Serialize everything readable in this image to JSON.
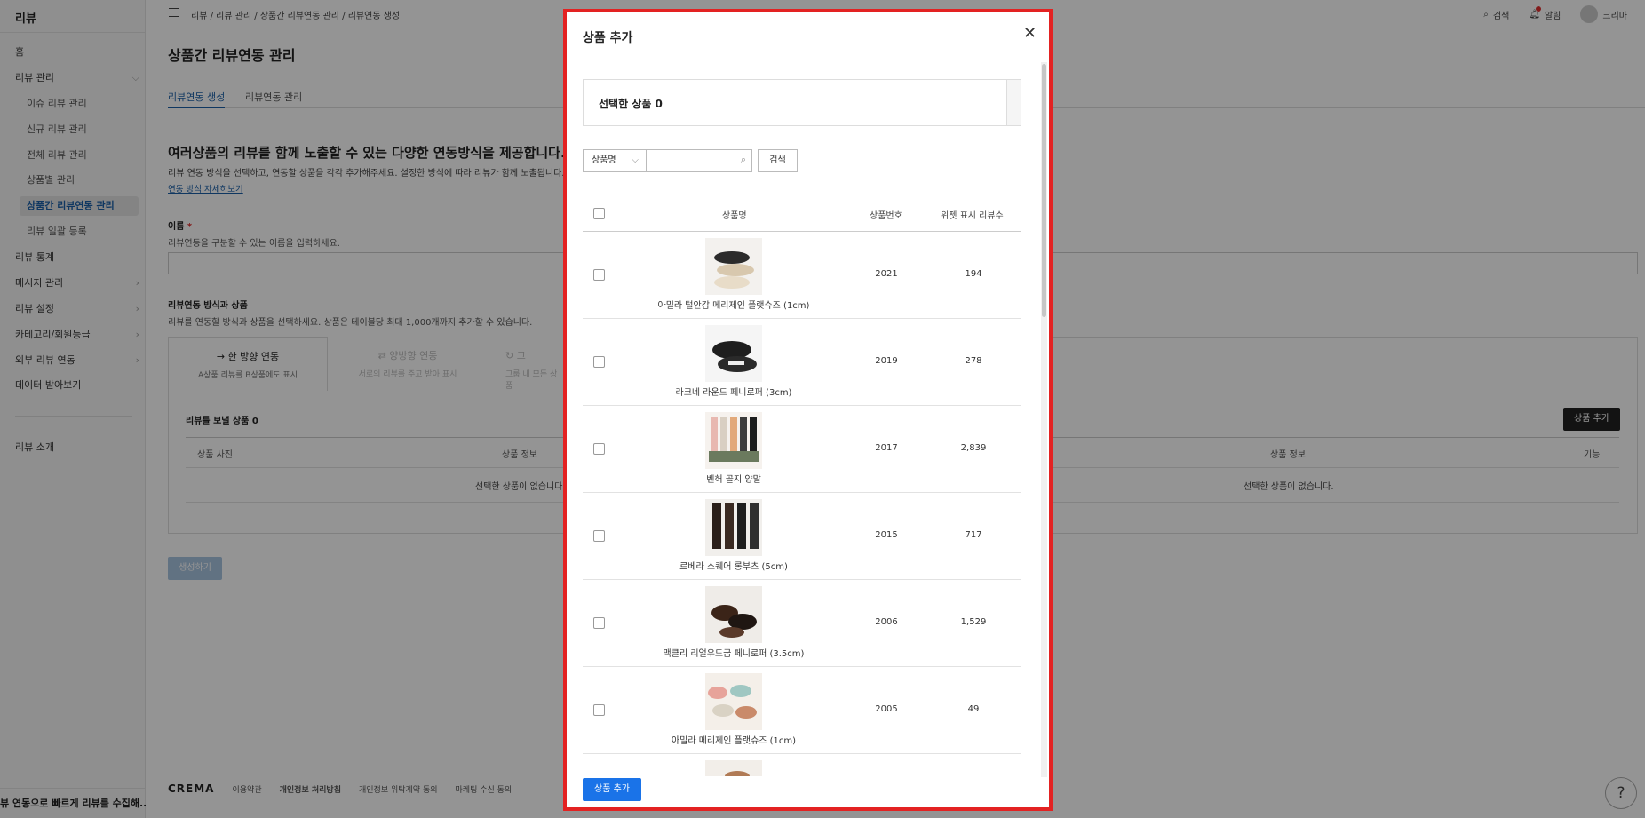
{
  "sidebar": {
    "title": "리뷰",
    "items": [
      {
        "label": "홈"
      },
      {
        "label": "리뷰 관리",
        "chevron": "⌵"
      },
      {
        "label": "이슈 리뷰 관리"
      },
      {
        "label": "신규 리뷰 관리"
      },
      {
        "label": "전체 리뷰 관리"
      },
      {
        "label": "상품별 관리"
      },
      {
        "label": "상품간 리뷰연동 관리"
      },
      {
        "label": "리뷰 일괄 등록"
      },
      {
        "label": "리뷰 통계"
      },
      {
        "label": "메시지 관리",
        "chevron": "›"
      },
      {
        "label": "리뷰 설정",
        "chevron": "›"
      },
      {
        "label": "카테고리/회원등급",
        "chevron": "›"
      },
      {
        "label": "외부 리뷰 연동",
        "chevron": "›"
      },
      {
        "label": "데이터 받아보기"
      },
      {
        "label": "리뷰 소개"
      }
    ],
    "bottom_text": "뷰 연동으로 빠르게 리뷰를 수집해..."
  },
  "topbar": {
    "breadcrumb": "리뷰  /  리뷰 관리  /  상품간 리뷰연동 관리  /  리뷰연동 생성",
    "search_label": "검색",
    "alarm_label": "알림",
    "user_label": "크리마"
  },
  "page": {
    "title": "상품간 리뷰연동 관리",
    "tabs": [
      "리뷰연동 생성",
      "리뷰연동 관리"
    ],
    "intro_title": "여러상품의 리뷰를 함께 노출할 수 있는 다양한 연동방식을 제공합니다.",
    "intro_desc": "리뷰 연동 방식을 선택하고, 연동할 상품을 각각 추가해주세요. 설정한 방식에 따라 리뷰가 함께 노출됩니다.",
    "intro_link": "연동 방식 자세히보기",
    "name_label": "이름",
    "name_required": "*",
    "name_help": "리뷰연동을 구분할 수 있는 이름을 입력하세요.",
    "method_label": "리뷰연동 방식과 상품",
    "method_help": "리뷰를 연동할 방식과 상품을 선택하세요. 상품은 테이블당 최대 1,000개까지 추가할 수 있습니다.",
    "modes": [
      {
        "title": "→  한 방향 연동",
        "desc": "A상품 리뷰를 B상품에도 표시"
      },
      {
        "title": "⇄  양방향 연동",
        "desc": "서로의 리뷰를 주고 받아 표시"
      },
      {
        "title": "↻  그",
        "desc": "그룹 내 모든 상품"
      }
    ],
    "send_label": "리뷰를 보낼 상품 0",
    "col_photo": "상품 사진",
    "col_info": "상품 정보",
    "col_info2": "상품 정보",
    "col_func": "기능",
    "empty_text": "선택한 상품이 없습니다.",
    "empty_text2": "선택한 상품이 없습니다.",
    "add_button": "상품 추가",
    "create_button": "생성하기"
  },
  "footer": {
    "brand": "CREMA",
    "links": [
      "이용약관",
      "개인정보 처리방침",
      "개인정보 위탁계약 동의",
      "마케팅 수신 동의"
    ]
  },
  "help_icon": "?",
  "modal": {
    "title": "상품 추가",
    "close": "✕",
    "selected_label": "선택한 상품 0",
    "search_field": "상품명",
    "search_input_placeholder": "",
    "search_button": "검색",
    "columns": {
      "name": "상품명",
      "number": "상품번호",
      "count": "위젯 표시 리뷰수"
    },
    "products": [
      {
        "name": "아밀라 털안감 메리제인 플랫슈즈 (1cm)",
        "number": "2021",
        "count": "194",
        "thumb": "shoes-cream-black"
      },
      {
        "name": "라크네 라운드 페니로퍼 (3cm)",
        "number": "2019",
        "count": "278",
        "thumb": "loafer-black-white"
      },
      {
        "name": "벤허 골지 양말",
        "number": "2017",
        "count": "2,839",
        "thumb": "socks-colors"
      },
      {
        "name": "르베라 스퀘어 롱부츠 (5cm)",
        "number": "2015",
        "count": "717",
        "thumb": "long-boots"
      },
      {
        "name": "맥클리 리얼우드굽 페니로퍼 (3.5cm)",
        "number": "2006",
        "count": "1,529",
        "thumb": "loafer-brown"
      },
      {
        "name": "아밀라 메리제인 플랫슈즈 (1cm)",
        "number": "2005",
        "count": "49",
        "thumb": "flats-pastel"
      },
      {
        "name": "",
        "number": "",
        "count": "",
        "thumb": "partial"
      }
    ],
    "add_button": "상품 추가"
  },
  "colors": {
    "accent": "#1a73e8",
    "frame": "#e32222",
    "active_nav": "#1a5fa8"
  }
}
